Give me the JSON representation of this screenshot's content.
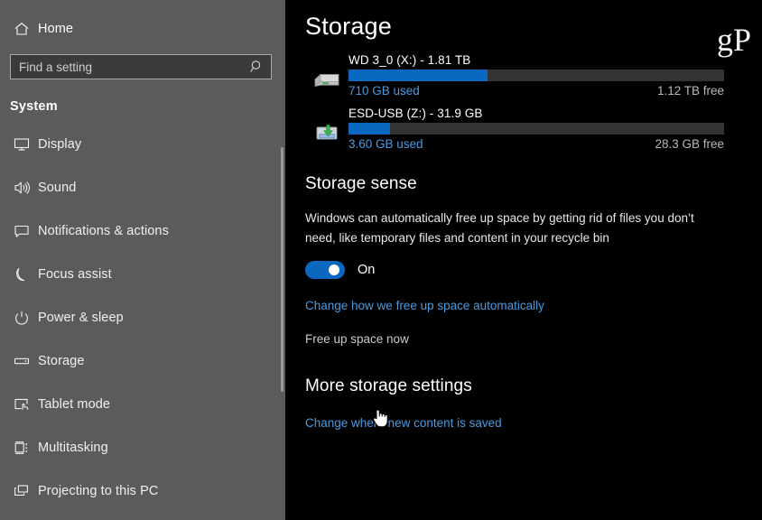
{
  "sidebar": {
    "home_label": "Home",
    "home_icon": "home-icon",
    "search": {
      "placeholder": "Find a setting",
      "value": "",
      "icon": "search-icon"
    },
    "section_header": "System",
    "items": [
      {
        "label": "Display",
        "icon": "monitor-icon"
      },
      {
        "label": "Sound",
        "icon": "speaker-icon"
      },
      {
        "label": "Notifications & actions",
        "icon": "chat-bubble-icon"
      },
      {
        "label": "Focus assist",
        "icon": "moon-icon"
      },
      {
        "label": "Power & sleep",
        "icon": "power-icon"
      },
      {
        "label": "Storage",
        "icon": "drive-icon"
      },
      {
        "label": "Tablet mode",
        "icon": "tablet-hand-icon"
      },
      {
        "label": "Multitasking",
        "icon": "multitasking-icon"
      },
      {
        "label": "Projecting to this PC",
        "icon": "projecting-icon"
      }
    ]
  },
  "main": {
    "title": "Storage",
    "watermark": "gP",
    "drives": [
      {
        "name": "WD 3_0 (X:) - 1.81 TB",
        "used_label": "710 GB used",
        "free_label": "1.12 TB free",
        "used_percent": 38,
        "icon": "hard-drive-icon"
      },
      {
        "name": "ESD-USB (Z:) - 31.9 GB",
        "used_label": "3.60 GB used",
        "free_label": "28.3 GB free",
        "used_percent": 11,
        "icon": "removable-drive-icon"
      }
    ],
    "storage_sense": {
      "heading": "Storage sense",
      "description": "Windows can automatically free up space by getting rid of files you don’t need, like temporary files and content in your recycle bin",
      "toggle_state": "On",
      "toggle_on": true,
      "link_change_auto": "Change how we free up space automatically",
      "link_free_now": "Free up space now"
    },
    "more_storage": {
      "heading": "More storage settings",
      "link_change_location": "Change where new content is saved"
    }
  },
  "colors": {
    "accent": "#0a68c1",
    "link": "#4b9ae0",
    "sidebar_bg": "#5b5b5b",
    "content_bg": "#000000",
    "bar_track": "#333333"
  }
}
